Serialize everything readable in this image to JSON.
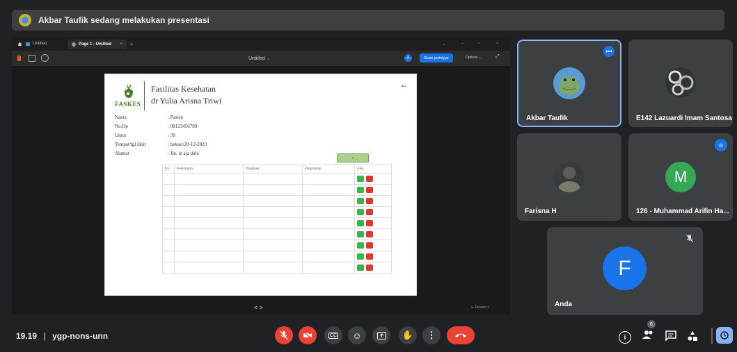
{
  "banner": {
    "text": "Akbar Taufik sedang melakukan presentasi"
  },
  "browser": {
    "tab1": "Untitled",
    "tab2": "Page 1 - Untitled",
    "title": "Untitled",
    "user_initial": "A",
    "share_label": "Share prototype",
    "options_label": "Options",
    "nav_label": "< >",
    "restart_label": "Restart"
  },
  "doc": {
    "brand": "FASKES",
    "title1": "Fasilitas Kesehatan",
    "title2": "dr Yulia Arisna Triwi",
    "fields": [
      {
        "label": "Nama",
        "value": ": Pasien"
      },
      {
        "label": "No.Hp",
        "value": ": 08123456789"
      },
      {
        "label": "Umur",
        "value": ": 30"
      },
      {
        "label": "Tempat/tgl lahir",
        "value": ": bekasi/20-12-2023"
      },
      {
        "label": "Alamat",
        "value": ": Jln. in aja dulu"
      }
    ],
    "add_label": "+",
    "columns": [
      "No",
      "Keterangan",
      "Diagnosa",
      "Pengobatan",
      "Aksi"
    ],
    "row_count": 9
  },
  "participants": [
    {
      "name": "Akbar Taufik"
    },
    {
      "name": "E142 Lazuardi Imam Santosa"
    },
    {
      "name": "Farisna H"
    },
    {
      "name": "126 - Muhammad Arifin Ha...",
      "initial": "M"
    },
    {
      "name": "Anda",
      "initial": "F"
    }
  ],
  "meeting": {
    "time": "19.19",
    "separator": "|",
    "code": "ygp-nons-unn",
    "people_count": "6"
  },
  "colors": {
    "accent": "#8ab4f8",
    "end_call": "#ea4335",
    "m_avatar": "#34a853",
    "f_avatar": "#1a73e8",
    "faskes_green": "#4a7c2a"
  }
}
